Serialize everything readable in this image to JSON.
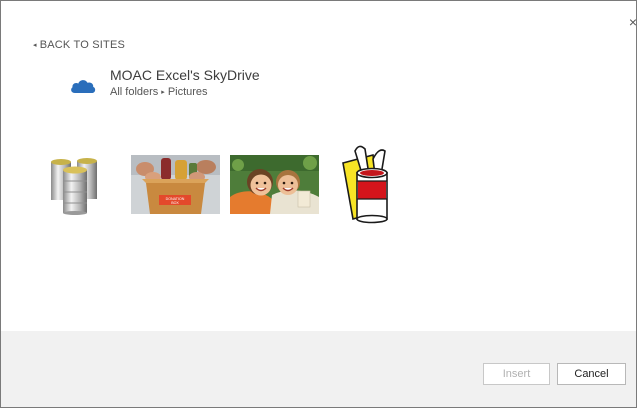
{
  "dialog": {
    "close_label": "×"
  },
  "back_link": {
    "label": "BACK TO SITES",
    "chevron": "◂"
  },
  "site": {
    "icon": "skydrive-cloud-icon",
    "title": "MOAC Excel's SkyDrive",
    "breadcrumb": [
      {
        "label": "All folders"
      },
      {
        "label": "Pictures"
      }
    ],
    "breadcrumb_separator": "▸"
  },
  "gallery": {
    "images": [
      {
        "name": "tin-cans"
      },
      {
        "name": "donation-box"
      },
      {
        "name": "smiling-children"
      },
      {
        "name": "soup-can-clipart"
      }
    ],
    "donation_box_text": [
      "DONATION",
      "BOX"
    ]
  },
  "footer": {
    "insert_label": "Insert",
    "cancel_label": "Cancel",
    "insert_enabled": false
  },
  "colors": {
    "accent_blue": "#2a6ebb",
    "footer_bg": "#f1f1f1",
    "disabled_text": "#b0b0b0"
  }
}
